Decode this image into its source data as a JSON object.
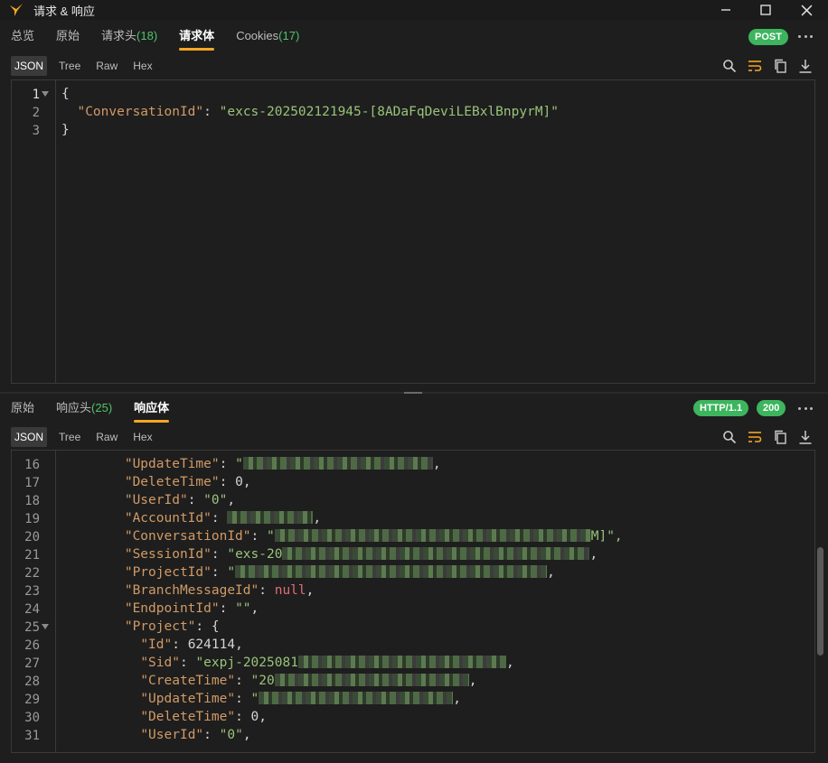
{
  "window": {
    "title": "请求 & 响应"
  },
  "request": {
    "tabs": [
      {
        "label": "总览",
        "count": ""
      },
      {
        "label": "原始",
        "count": ""
      },
      {
        "label": "请求头",
        "count": "(18)"
      },
      {
        "label": "请求体",
        "count": ""
      },
      {
        "label": "Cookies",
        "count": "(17)"
      }
    ],
    "method_badge": "POST",
    "formats": [
      "JSON",
      "Tree",
      "Raw",
      "Hex"
    ],
    "line_numbers": [
      "1",
      "2",
      "3"
    ],
    "body": {
      "open_brace": "{",
      "key": "\"ConversationId\"",
      "value": "\"excs-202502121945-[8ADaFqDeviLEBxlBnpyrM]\"",
      "close_brace": "}"
    }
  },
  "response": {
    "tabs": [
      {
        "label": "原始",
        "count": ""
      },
      {
        "label": "响应头",
        "count": "(25)"
      },
      {
        "label": "响应体",
        "count": ""
      }
    ],
    "http_badge": "HTTP/1.1",
    "status_badge": "200",
    "formats": [
      "JSON",
      "Tree",
      "Raw",
      "Hex"
    ],
    "lines": [
      {
        "n": "16",
        "key": "\"UpdateTime\"",
        "value": "\"",
        "redacted": true,
        "tail": ","
      },
      {
        "n": "17",
        "key": "\"DeleteTime\"",
        "value": "0",
        "type": "num",
        "tail": ","
      },
      {
        "n": "18",
        "key": "\"UserId\"",
        "value": "\"0\"",
        "tail": ","
      },
      {
        "n": "19",
        "key": "\"AccountId\"",
        "value": "",
        "redacted": true,
        "tail": ","
      },
      {
        "n": "20",
        "key": "\"ConversationId\"",
        "value": "\"",
        "redacted": true,
        "tail": "M]\","
      },
      {
        "n": "21",
        "key": "\"SessionId\"",
        "value": "\"exs-20",
        "redacted": true,
        "tail": ","
      },
      {
        "n": "22",
        "key": "\"ProjectId\"",
        "value": "\"",
        "redacted": true,
        "tail": ","
      },
      {
        "n": "23",
        "key": "\"BranchMessageId\"",
        "value": "null",
        "type": "null",
        "tail": ","
      },
      {
        "n": "24",
        "key": "\"EndpointId\"",
        "value": "\"\"",
        "tail": ","
      },
      {
        "n": "25",
        "key": "\"Project\"",
        "value": "{",
        "type": "brace",
        "tail": ""
      },
      {
        "n": "26",
        "key": "\"Id\"",
        "value": "624114",
        "type": "num",
        "tail": ",",
        "indent": 2
      },
      {
        "n": "27",
        "key": "\"Sid\"",
        "value": "\"expj-2025081",
        "redacted": true,
        "tail": ",",
        "indent": 2
      },
      {
        "n": "28",
        "key": "\"CreateTime\"",
        "value": "\"20",
        "redacted": true,
        "tail": ",",
        "indent": 2
      },
      {
        "n": "29",
        "key": "\"UpdateTime\"",
        "value": "\"",
        "redacted": true,
        "tail": ",",
        "indent": 2
      },
      {
        "n": "30",
        "key": "\"DeleteTime\"",
        "value": "0",
        "type": "num",
        "tail": ",",
        "indent": 2
      },
      {
        "n": "31",
        "key": "\"UserId\"",
        "value": "\"0\"",
        "tail": ",",
        "indent": 2
      }
    ]
  }
}
